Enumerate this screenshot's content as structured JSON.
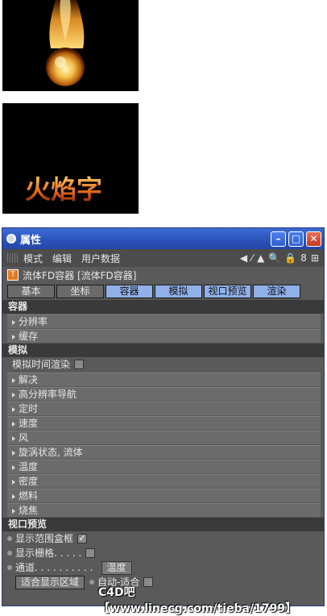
{
  "renders": [
    {
      "name": "fireball render"
    },
    {
      "name": "flame text render",
      "text": "火焰字"
    }
  ],
  "window": {
    "title": "属性",
    "buttons": [
      "minimize",
      "maximize",
      "close"
    ]
  },
  "menu": {
    "items": [
      "模式",
      "编辑",
      "用户数据"
    ],
    "tools": [
      "◀",
      "⁄",
      "▲",
      "🔍",
      "🔒",
      "8",
      "⊞"
    ]
  },
  "object": {
    "label": "流体FD容器 [流体FD容器]"
  },
  "tabs": [
    {
      "label": "基本",
      "active": false
    },
    {
      "label": "坐标",
      "active": false
    },
    {
      "label": "容器",
      "active": true
    },
    {
      "label": "模拟",
      "active": true
    },
    {
      "label": "视口预览",
      "active": true
    },
    {
      "label": "渲染",
      "active": true
    }
  ],
  "sections": {
    "container": {
      "title": "容器",
      "groups": [
        "分辨率",
        "缓存"
      ]
    },
    "simulate": {
      "title": "模拟",
      "param": "模拟时间渲染",
      "groups": [
        "解决",
        "高分辨率导航",
        "定时",
        "速度",
        "风",
        "旋涡状态, 流体",
        "温度",
        "密度",
        "燃料",
        "烧焦"
      ]
    },
    "viewport": {
      "title": "视口预览",
      "params": [
        "显示范围盒框",
        "显示栅格. . . . ."
      ],
      "checks": [
        "✓",
        ""
      ],
      "channel_label": "通道",
      "channel_dots": ". . . . . . . . . .",
      "channel_value": "温度",
      "fit_button": "适合显示区域",
      "auto_fit": "自动-适合"
    }
  },
  "watermark": "C4D吧 【www.linecg.com/tieba/1799】"
}
